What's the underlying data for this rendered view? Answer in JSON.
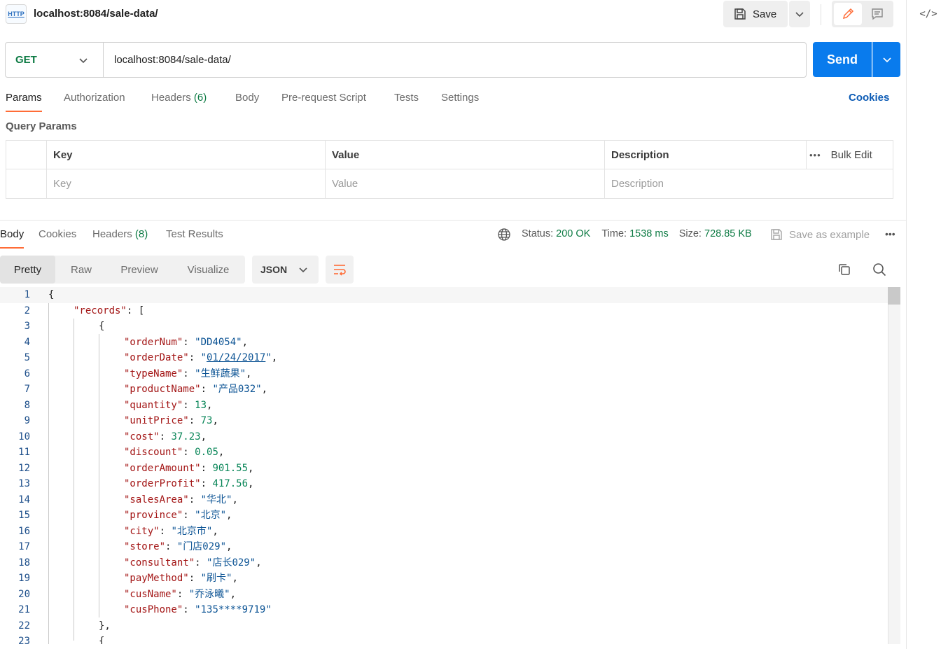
{
  "header": {
    "tab_title": "localhost:8084/sale-data/",
    "http_badge": "HTTP",
    "save_label": "Save"
  },
  "request": {
    "method": "GET",
    "url": "localhost:8084/sale-data/",
    "send_label": "Send",
    "tabs": [
      {
        "label": "Params",
        "count": ""
      },
      {
        "label": "Authorization",
        "count": ""
      },
      {
        "label": "Headers",
        "count": "(6)"
      },
      {
        "label": "Body",
        "count": ""
      },
      {
        "label": "Pre-request Script",
        "count": ""
      },
      {
        "label": "Tests",
        "count": ""
      },
      {
        "label": "Settings",
        "count": ""
      }
    ],
    "cookies_label": "Cookies",
    "query_params_title": "Query Params",
    "table": {
      "headers": [
        "Key",
        "Value",
        "Description"
      ],
      "placeholders": [
        "Key",
        "Value",
        "Description"
      ],
      "bulk_edit": "Bulk Edit"
    }
  },
  "response": {
    "tabs": [
      {
        "label": "Body",
        "count": ""
      },
      {
        "label": "Cookies",
        "count": ""
      },
      {
        "label": "Headers",
        "count": "(8)"
      },
      {
        "label": "Test Results",
        "count": ""
      }
    ],
    "status_label": "Status:",
    "status_value": "200 OK",
    "time_label": "Time:",
    "time_value": "1538 ms",
    "size_label": "Size:",
    "size_value": "728.85 KB",
    "save_example": "Save as example",
    "formats": [
      "Pretty",
      "Raw",
      "Preview",
      "Visualize"
    ],
    "language": "JSON",
    "lines": [
      {
        "num": "1",
        "indent": 0,
        "text": "{"
      },
      {
        "num": "2",
        "indent": 1,
        "key": "records",
        "punct": ": ["
      },
      {
        "num": "3",
        "indent": 2,
        "text": "{"
      },
      {
        "num": "4",
        "indent": 3,
        "key": "orderNum",
        "str": "DD4054",
        "comma": ","
      },
      {
        "num": "5",
        "indent": 3,
        "key": "orderDate",
        "str": "01/24/2017",
        "comma": ",",
        "underline": true
      },
      {
        "num": "6",
        "indent": 3,
        "key": "typeName",
        "str": "生鲜蔬果",
        "comma": ","
      },
      {
        "num": "7",
        "indent": 3,
        "key": "productName",
        "str": "产品032",
        "comma": ","
      },
      {
        "num": "8",
        "indent": 3,
        "key": "quantity",
        "num_val": "13",
        "comma": ","
      },
      {
        "num": "9",
        "indent": 3,
        "key": "unitPrice",
        "num_val": "73",
        "comma": ","
      },
      {
        "num": "10",
        "indent": 3,
        "key": "cost",
        "num_val": "37.23",
        "comma": ","
      },
      {
        "num": "11",
        "indent": 3,
        "key": "discount",
        "num_val": "0.05",
        "comma": ","
      },
      {
        "num": "12",
        "indent": 3,
        "key": "orderAmount",
        "num_val": "901.55",
        "comma": ","
      },
      {
        "num": "13",
        "indent": 3,
        "key": "orderProfit",
        "num_val": "417.56",
        "comma": ","
      },
      {
        "num": "14",
        "indent": 3,
        "key": "salesArea",
        "str": "华北",
        "comma": ","
      },
      {
        "num": "15",
        "indent": 3,
        "key": "province",
        "str": "北京",
        "comma": ","
      },
      {
        "num": "16",
        "indent": 3,
        "key": "city",
        "str": "北京市",
        "comma": ","
      },
      {
        "num": "17",
        "indent": 3,
        "key": "store",
        "str": "门店029",
        "comma": ","
      },
      {
        "num": "18",
        "indent": 3,
        "key": "consultant",
        "str": "店长029",
        "comma": ","
      },
      {
        "num": "19",
        "indent": 3,
        "key": "payMethod",
        "str": "刷卡",
        "comma": ","
      },
      {
        "num": "20",
        "indent": 3,
        "key": "cusName",
        "str": "乔泳曦",
        "comma": ","
      },
      {
        "num": "21",
        "indent": 3,
        "key": "cusPhone",
        "str": "135****9719",
        "comma": ""
      },
      {
        "num": "22",
        "indent": 2,
        "text": "},"
      },
      {
        "num": "23",
        "indent": 2,
        "text": "{"
      }
    ]
  },
  "colors": {
    "accent": "#ff6c37",
    "send": "#097bed",
    "method": "#0c7a43",
    "status_ok": "#0c7a43"
  }
}
